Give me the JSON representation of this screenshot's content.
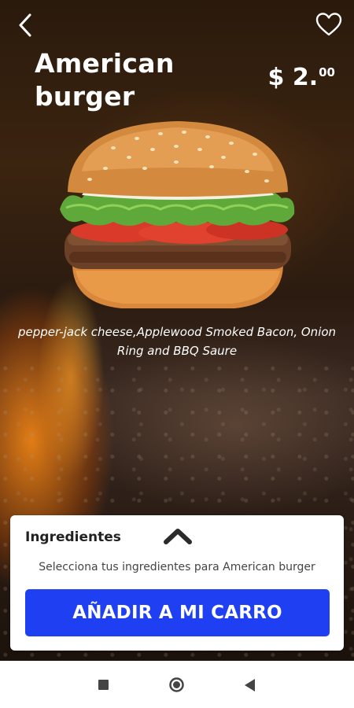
{
  "product": {
    "name": "American burger",
    "price_main": "$ 2.",
    "price_cents": "00",
    "description": "pepper-jack cheese,Applewood Smoked Bacon, Onion Ring and BBQ Saure"
  },
  "icons": {
    "back": "chevron-left-icon",
    "favorite": "heart-outline-icon",
    "expand": "chevron-up-icon",
    "nav_recents": "square-icon",
    "nav_home": "circle-icon",
    "nav_back": "triangle-left-icon"
  },
  "card": {
    "header": "Ingredientes",
    "subtitle": "Selecciona tus ingredientes para American burger",
    "add_button_label": "AÑADIR A MI CARRO"
  },
  "colors": {
    "accent": "#1f3ff2",
    "text_light": "#ffffff"
  }
}
